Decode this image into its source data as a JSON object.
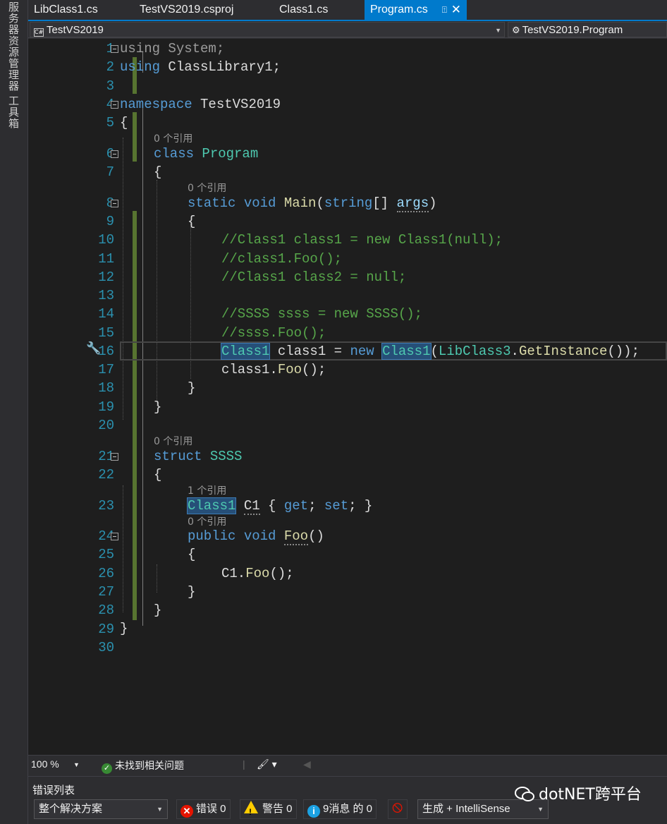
{
  "side_tabs": [
    "服务器资源管理器",
    "工具箱"
  ],
  "tabs": [
    {
      "label": "LibClass1.cs"
    },
    {
      "label": "TestVS2019.csproj"
    },
    {
      "label": "Class1.cs"
    },
    {
      "label": "Program.cs",
      "active": true
    }
  ],
  "tab_icons": {
    "pin": "pin-icon",
    "close": "close-icon"
  },
  "navbar": {
    "project": "TestVS2019",
    "project_icon": "C#",
    "type": "TestVS2019.Program"
  },
  "line_numbers": [
    "1",
    "2",
    "3",
    "4",
    "5",
    "6",
    "7",
    "8",
    "9",
    "10",
    "11",
    "12",
    "13",
    "14",
    "15",
    "16",
    "17",
    "18",
    "19",
    "20",
    "21",
    "22",
    "23",
    "24",
    "25",
    "26",
    "27",
    "28",
    "29",
    "30"
  ],
  "codelens": {
    "program": "0 个引用",
    "main": "0 个引用",
    "ssss": "0 个引用",
    "c1": "1 个引用",
    "foo": "0 个引用"
  },
  "code": {
    "l1_kw": "using",
    "l1_rest": " System;",
    "l2_kw": "using",
    "l2_rest": " ClassLibrary1;",
    "l4_kw": "namespace",
    "l4_rest": " TestVS2019",
    "l5": "{",
    "l6_kw": "class",
    "l6_type": "Program",
    "l7": "{",
    "l8_kw1": "static",
    "l8_kw2": "void",
    "l8_method": "Main",
    "l8_open": "(",
    "l8_kw3": "string",
    "l8_arr": "[] ",
    "l8_param": "args",
    "l8_close": ")",
    "l9": "{",
    "l10": "//Class1 class1 = new Class1(null);",
    "l11": "//class1.Foo();",
    "l12": "//Class1 class2 = null;",
    "l14": "//SSSS ssss = new SSSS();",
    "l15": "//ssss.Foo();",
    "l16_t1": "Class1",
    "l16_mid": " class1 = ",
    "l16_new": "new",
    "l16_t2": "Class1",
    "l16_open": "(",
    "l16_t3": "LibClass3",
    "l16_dot": ".",
    "l16_m": "GetInstance",
    "l16_end": "());",
    "l17_a": "class1.",
    "l17_m": "Foo",
    "l17_b": "();",
    "l18": "}",
    "l19": "}",
    "l21_kw": "struct",
    "l21_type": "SSSS",
    "l22": "{",
    "l23_t": "Class1",
    "l23_name": "C1",
    "l23_a": " { ",
    "l23_get": "get",
    "l23_b": "; ",
    "l23_set": "set",
    "l23_c": "; }",
    "l24_kw1": "public",
    "l24_kw2": "void",
    "l24_m": "Foo",
    "l24_b": "()",
    "l25": "{",
    "l26_a": "C1.",
    "l26_m": "Foo",
    "l26_b": "();",
    "l27": "}",
    "l28": "}",
    "l29": "}"
  },
  "status": {
    "zoom": "100 %",
    "issues": "未找到相关问题"
  },
  "error_list": {
    "title": "错误列表",
    "scope": "整个解决方案",
    "errors": "错误 0",
    "warnings": "警告 0",
    "messages": "9消息 的 0",
    "build": "生成 + IntelliSense"
  },
  "watermark": "dotNET跨平台",
  "colors": {
    "accent": "#007acc",
    "keyword": "#569cd6",
    "type": "#4ec9b0",
    "comment": "#57a64a",
    "method": "#dcdcaa",
    "line_number": "#2b91af",
    "change_bar": "#577430"
  }
}
